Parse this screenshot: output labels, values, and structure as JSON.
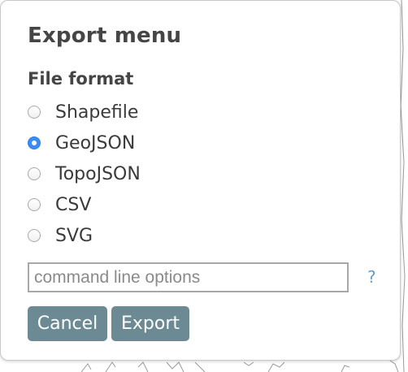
{
  "dialog": {
    "title": "Export menu",
    "section_label": "File format",
    "formats": [
      {
        "label": "Shapefile",
        "checked": false
      },
      {
        "label": "GeoJSON",
        "checked": true
      },
      {
        "label": "TopoJSON",
        "checked": false
      },
      {
        "label": "CSV",
        "checked": false
      },
      {
        "label": "SVG",
        "checked": false
      }
    ],
    "options_input": {
      "placeholder": "command line options",
      "value": ""
    },
    "help_label": "?",
    "cancel_label": "Cancel",
    "export_label": "Export"
  },
  "colors": {
    "button_bg": "#6c8a94",
    "radio_checked": "#3b8cf2",
    "help_link": "#6a9bc6",
    "text": "#454545"
  }
}
